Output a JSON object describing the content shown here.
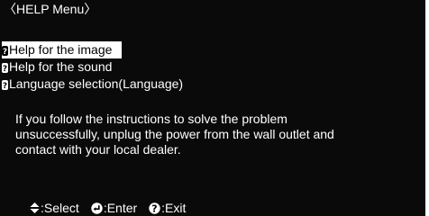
{
  "menu_title": "〈HELP Menu〉",
  "menu_items": [
    {
      "label": "Help for the image",
      "icon": "help-icon",
      "selected": true
    },
    {
      "label": "Help for the sound",
      "icon": "help-icon",
      "selected": false
    },
    {
      "label": "Language selection(Language)",
      "icon": "help-icon",
      "selected": false
    }
  ],
  "message_lines": [
    "If you follow the instructions to solve the problem",
    "unsuccessfully, unplug the power from the wall outlet and",
    "contact with your local dealer."
  ],
  "footer": {
    "select_label": ":Select",
    "enter_label": ":Enter",
    "exit_label": ":Exit"
  },
  "colors": {
    "background": "#0a0a0a",
    "text": "#ffffff",
    "highlight_bg": "#ffffff",
    "highlight_text": "#000000"
  }
}
